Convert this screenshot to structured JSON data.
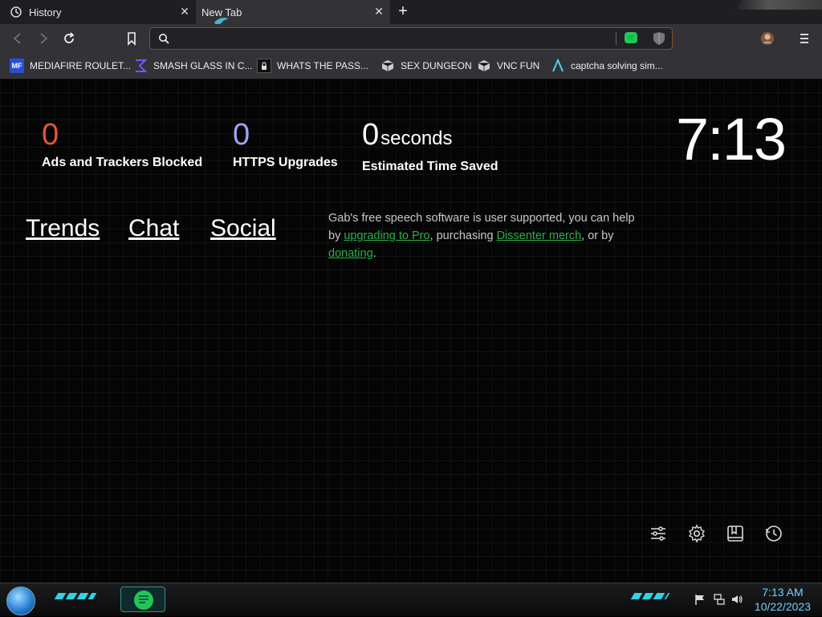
{
  "tabs": [
    {
      "label": "History",
      "icon": "history-icon"
    },
    {
      "label": "New Tab",
      "icon": "gab-icon"
    }
  ],
  "urlbar": {
    "value": "",
    "placeholder": ""
  },
  "bookmarks": [
    {
      "label": "MEDIAFIRE ROULET...",
      "icon_text": "MF"
    },
    {
      "label": "SMASH GLASS IN C...",
      "icon_text": ""
    },
    {
      "label": "WHATS THE PASS...",
      "icon_text": ""
    },
    {
      "label": "SEX DUNGEON",
      "icon_text": ""
    },
    {
      "label": "VNC FUN",
      "icon_text": ""
    },
    {
      "label": "captcha solving sim...",
      "icon_text": ""
    }
  ],
  "stats": {
    "ads": {
      "value": "0",
      "label": "Ads and Trackers Blocked",
      "color": "#e8543a"
    },
    "https": {
      "value": "0",
      "label": "HTTPS Upgrades",
      "color": "#9da7f5"
    },
    "time": {
      "value": "0",
      "unit": "seconds",
      "label": "Estimated Time Saved"
    }
  },
  "clock": "7:13",
  "nav_links": [
    "Trends",
    "Chat",
    "Social"
  ],
  "gab_note": {
    "pre": "Gab's free speech software is user supported, you can help by ",
    "link1": "upgrading to Pro",
    "mid1": ", purchasing ",
    "link2": "Dissenter merch",
    "mid2": ", or by ",
    "link3": "donating",
    "post": "."
  },
  "taskbar": {
    "time": "7:13 AM",
    "date": "10/22/2023"
  }
}
